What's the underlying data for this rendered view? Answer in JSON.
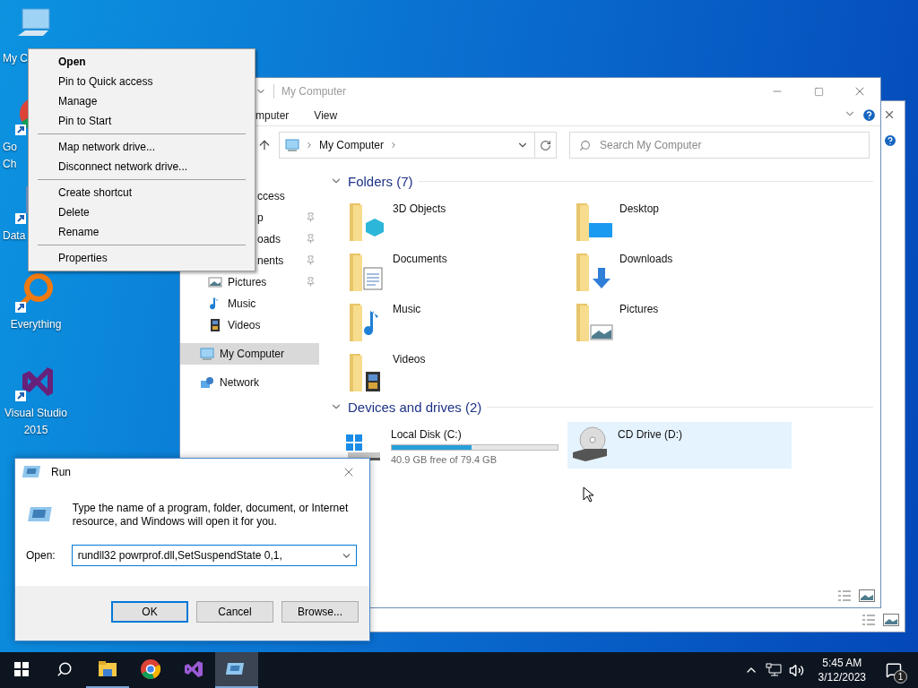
{
  "desktop_icons": [
    {
      "kind": "computer",
      "lines": [
        "My C"
      ],
      "partial": true
    },
    {
      "kind": "chrome",
      "lines": [
        "Go",
        "Ch"
      ],
      "partial": true
    },
    {
      "kind": "data",
      "lines": [
        "Data"
      ],
      "partial": true
    },
    {
      "kind": "everything",
      "lines": [
        "Everything"
      ],
      "partial": false
    },
    {
      "kind": "studio",
      "lines": [
        "Visual Studio",
        "2015"
      ],
      "partial": false
    }
  ],
  "explorer": {
    "title": "My Computer",
    "ribbon_tabs": [
      "mputer",
      "View"
    ],
    "address": "My Computer",
    "search": {
      "placeholder": "Search My Computer"
    },
    "nav": [
      {
        "kind": "covered",
        "label": "ccess",
        "pinned": false,
        "selected": false
      },
      {
        "kind": "covered",
        "label": "p",
        "pinned": true,
        "selected": false
      },
      {
        "kind": "covered",
        "label": "oads",
        "pinned": true,
        "selected": false
      },
      {
        "kind": "covered",
        "label": "nents",
        "pinned": true,
        "selected": false
      },
      {
        "kind": "pictures",
        "label": "Pictures",
        "pinned": true,
        "selected": false
      },
      {
        "kind": "music",
        "label": "Music",
        "pinned": false,
        "selected": false
      },
      {
        "kind": "videos",
        "label": "Videos",
        "pinned": false,
        "selected": false
      },
      {
        "kind": "computer",
        "label": "My Computer",
        "pinned": false,
        "selected": true
      },
      {
        "kind": "network",
        "label": "Network",
        "pinned": false,
        "selected": false
      }
    ],
    "folders_header": "Folders (7)",
    "folders": [
      {
        "kind": "objects",
        "label": "3D Objects"
      },
      {
        "kind": "desktop",
        "label": "Desktop"
      },
      {
        "kind": "documents",
        "label": "Documents"
      },
      {
        "kind": "downloads",
        "label": "Downloads"
      },
      {
        "kind": "music",
        "label": "Music"
      },
      {
        "kind": "pictures",
        "label": "Pictures"
      },
      {
        "kind": "videos",
        "label": "Videos"
      }
    ],
    "drives_header": "Devices and drives (2)",
    "drives": [
      {
        "kind": "disk",
        "label": "Local Disk (C:)",
        "level": 0.48,
        "free": "40.9 GB free of 79.4 GB",
        "selected": false
      },
      {
        "kind": "optical",
        "label": "CD Drive (D:)",
        "selected": true
      }
    ]
  },
  "context_menu": [
    {
      "kind": "item",
      "label": "Open",
      "default": true
    },
    {
      "kind": "item",
      "label": "Pin to Quick access",
      "default": false
    },
    {
      "kind": "item",
      "label": "Manage",
      "default": false
    },
    {
      "kind": "item",
      "label": "Pin to Start",
      "default": false
    },
    {
      "kind": "separator"
    },
    {
      "kind": "item",
      "label": "Map network drive...",
      "default": false
    },
    {
      "kind": "item",
      "label": "Disconnect network drive...",
      "default": false
    },
    {
      "kind": "separator"
    },
    {
      "kind": "item",
      "label": "Create shortcut",
      "default": false
    },
    {
      "kind": "item",
      "label": "Delete",
      "default": false
    },
    {
      "kind": "item",
      "label": "Rename",
      "default": false
    },
    {
      "kind": "separator"
    },
    {
      "kind": "item",
      "label": "Properties",
      "default": false
    }
  ],
  "run_dialog": {
    "title": "Run",
    "message": "Type the name of a program, folder, document, or Internet resource, and Windows will open it for you.",
    "open_label": "Open:",
    "value": "rundll32 powrprof.dll,SetSuspendState 0,1,",
    "buttons": [
      {
        "label": "OK",
        "default": true
      },
      {
        "label": "Cancel",
        "default": false
      },
      {
        "label": "Browse...",
        "default": false
      }
    ]
  },
  "taskbar": {
    "apps": [
      {
        "kind": "explorer",
        "running": true,
        "active": false
      },
      {
        "kind": "chrome",
        "running": false,
        "active": false
      },
      {
        "kind": "studio",
        "running": false,
        "active": false
      },
      {
        "kind": "run",
        "running": true,
        "active": true
      }
    ],
    "time": "5:45 AM",
    "date": "3/12/2023",
    "notifications": "1"
  }
}
